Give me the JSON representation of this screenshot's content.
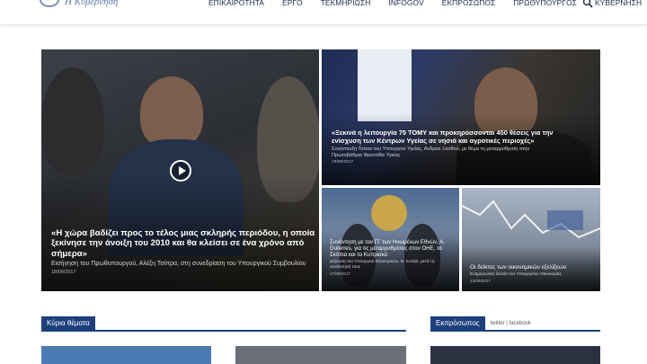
{
  "header": {
    "site_name": "Η Κυβέρνηση",
    "nav": [
      "ΕΠΙΚΑΙΡΟΤΗΤΑ",
      "ΕΡΓΟ",
      "ΤΕΚΜΗΡΙΩΣΗ",
      "INFOGOV",
      "ΕΚΠΡΟΣΩΠΟΣ",
      "ΠΡΩΘΥΠΟΥΡΓΟΣ",
      "ΚΥΒΕΡΝΗΣΗ"
    ]
  },
  "hero": {
    "main": {
      "title": "«Η χώρα βαδίζει προς το τέλος μιας σκληρής περιόδου, η οποία ξεκίνησε την άνοιξη του 2010 και θα κλείσει σε ένα χρόνο από σήμερα»",
      "subtitle": "Εισήγηση του Πρωθυπουργού, Αλέξη Τσίπρα, στη συνεδρίαση του Υπουργικού Συμβουλίου",
      "date": "18/09/2017"
    },
    "top_right": {
      "title": "«Ξεκινά η λειτουργία 75 ΤΟΜΥ και προκηρύσσονται 450 θέσεις για την ενίσχυση των Κέντρων Υγείας σε νησιά και αγροτικές περιοχές»",
      "subtitle": "Συνέντευξη Τύπου του Υπουργού Υγείας, Ανδρέα Ξανθού, με θέμα τη μεταρρύθμιση στην Πρωτοβάθμια Φροντίδα Υγείας",
      "date": "19/09/2017"
    },
    "bottom_left": {
      "title": "Συνάντηση με τον ΓΓ των Ηνωμένων Εθνών, Α. Guterres, για τις μεταρρυθμίσεις στον ΟΗΕ, τα Σκόπια και το Κυπριακό",
      "subtitle": "Δήλωση του Υπουργού Εξωτερικών, Ν. Κοτζιά, μετά τη συνάντησή τους",
      "date": "17/09/2017"
    },
    "bottom_right": {
      "title": "Οι δείκτες των οικονομικών εξελίξεων",
      "subtitle": "Ενημερωτικό δελτίο του Υπουργείου Οικονομίας",
      "date": "13/09/2017"
    }
  },
  "sections": {
    "main_topics": "Κύρια θέματα",
    "spokesperson": "Εκπρόσωπος",
    "social": "twitter | facebook"
  },
  "colors": {
    "brand": "#1e3f7d",
    "nav_text": "#1b2a44"
  }
}
